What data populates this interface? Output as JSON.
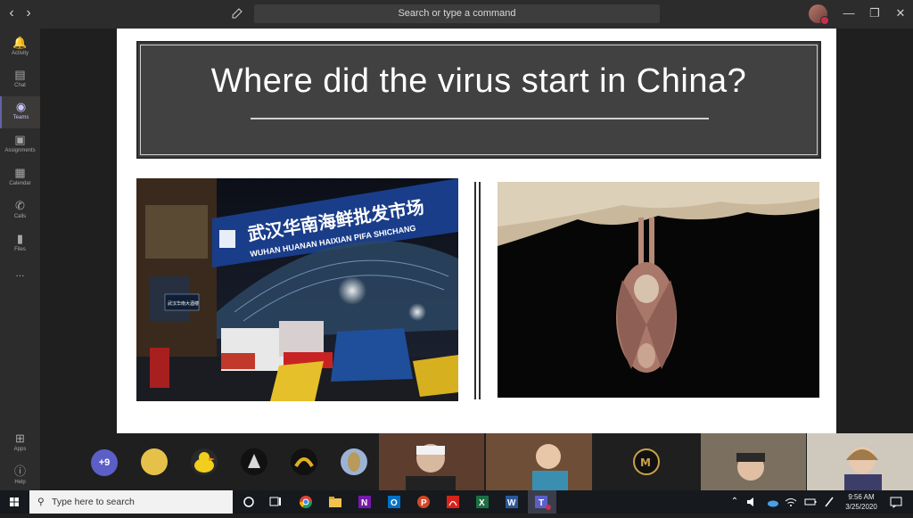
{
  "titlebar": {
    "back_icon": "chevron-left-icon",
    "forward_icon": "chevron-right-icon",
    "search_placeholder": "Search or type a command"
  },
  "rail": {
    "items": [
      {
        "label": "Activity",
        "icon": "bell-icon"
      },
      {
        "label": "Chat",
        "icon": "chat-icon"
      },
      {
        "label": "Teams",
        "icon": "teams-icon",
        "active": true
      },
      {
        "label": "Assignments",
        "icon": "assignments-icon"
      },
      {
        "label": "Calendar",
        "icon": "calendar-icon"
      },
      {
        "label": "Calls",
        "icon": "phone-icon"
      },
      {
        "label": "Files",
        "icon": "files-icon"
      },
      {
        "label": "...",
        "icon": "more-icon"
      }
    ],
    "bottom": [
      {
        "label": "Apps",
        "icon": "apps-icon"
      },
      {
        "label": "Help",
        "icon": "help-icon"
      }
    ]
  },
  "slide": {
    "title": "Where did the virus start in China?",
    "left_image": {
      "sign_chinese": "武汉华南海鲜批发市场",
      "sign_latin": "WUHAN HUANAN HAIXIAN PIFA SHICHANG",
      "small_sign": "武汉华南大酒楼"
    },
    "right_image": "bat-hanging-photo"
  },
  "participants": {
    "overflow_badge": "+9"
  },
  "taskbar": {
    "search_placeholder": "Type here to search",
    "time": "9:56 AM",
    "date": "3/25/2020"
  },
  "colors": {
    "accent": "#6264a7",
    "slide_title_bg": "#414141",
    "taskbar_bg": "#16191e"
  }
}
